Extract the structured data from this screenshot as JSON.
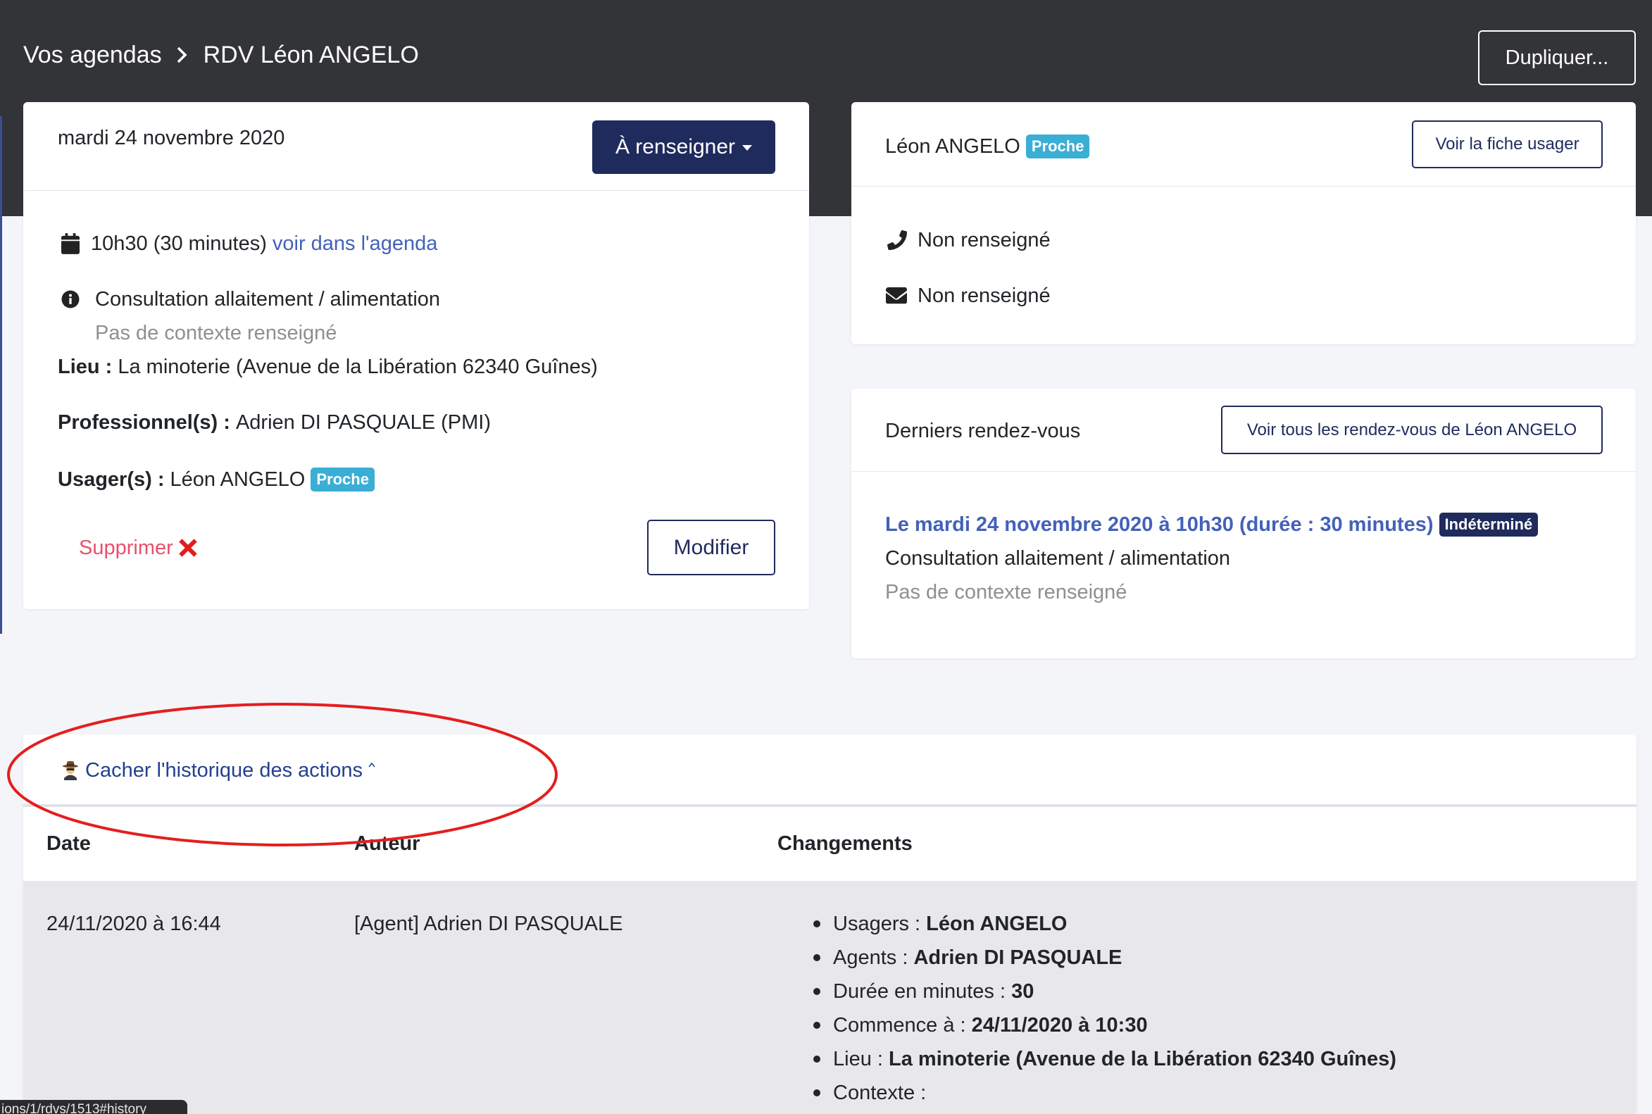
{
  "header": {
    "breadcrumb": {
      "parent": "Vos agendas",
      "current": "RDV Léon ANGELO"
    },
    "duplicate_label": "Dupliquer..."
  },
  "rdv_card": {
    "date": "mardi 24 novembre 2020",
    "status_label": "À renseigner",
    "time": "10h30 (30 minutes)",
    "agenda_link": "voir dans l'agenda",
    "motif": "Consultation allaitement / alimentation",
    "context": "Pas de contexte renseigné",
    "lieu": {
      "label": "Lieu :",
      "value": "La minoterie (Avenue de la Libération 62340 Guînes)"
    },
    "professionnels": {
      "label": "Professionnel(s) :",
      "value": "Adrien DI PASQUALE (PMI)"
    },
    "usagers": {
      "label": "Usager(s) :",
      "value": "Léon ANGELO",
      "badge": "Proche"
    },
    "delete_label": "Supprimer",
    "edit_label": "Modifier"
  },
  "user_card": {
    "name": "Léon ANGELO",
    "badge": "Proche",
    "profile_button": "Voir la fiche usager",
    "phone": "Non renseigné",
    "email": "Non renseigné"
  },
  "last_rdvs": {
    "title": "Derniers rendez-vous",
    "all_button": "Voir tous les rendez-vous de Léon ANGELO",
    "items": [
      {
        "link": "Le mardi 24 novembre 2020 à 10h30 (durée : 30 minutes)",
        "status": "Indéterminé",
        "motif": "Consultation allaitement / alimentation",
        "context": "Pas de contexte renseigné"
      }
    ]
  },
  "history": {
    "toggle_label": "Cacher l'historique des actions",
    "columns": [
      "Date",
      "Auteur",
      "Changements"
    ],
    "rows": [
      {
        "date": "24/11/2020 à 16:44",
        "author": "[Agent] Adrien DI PASQUALE",
        "changes": [
          {
            "label": "Usagers :",
            "value": "Léon ANGELO"
          },
          {
            "label": "Agents :",
            "value": "Adrien DI PASQUALE"
          },
          {
            "label": "Durée en minutes :",
            "value": "30"
          },
          {
            "label": "Commence à :",
            "value": "24/11/2020 à 10:30"
          },
          {
            "label": "Lieu :",
            "value": "La minoterie (Avenue de la Libération 62340 Guînes)"
          },
          {
            "label": "Contexte :",
            "value": ""
          }
        ]
      }
    ]
  },
  "status_bar": {
    "url": "ions/1/rdvs/1513#history"
  },
  "icons": {
    "breadcrumb_separator": "chevron-right-icon",
    "time": "calendar-icon",
    "motif": "info-circle-icon",
    "delete": "red-cross-icon",
    "phone": "phone-icon",
    "email": "envelope-icon",
    "history_toggle": "detective-icon",
    "history_collapse": "caret-up-icon",
    "status_dropdown": "caret-down-icon"
  },
  "colors": {
    "header_bg": "#333438",
    "navy": "#1f2b5c",
    "link": "#4361b9",
    "history_link": "#23418f",
    "badge_proche": "#3aaed4",
    "danger": "#e8506b",
    "muted": "#8f8f8f",
    "table_row_bg": "#e8e8ea",
    "annotation": "#e41e1e"
  }
}
